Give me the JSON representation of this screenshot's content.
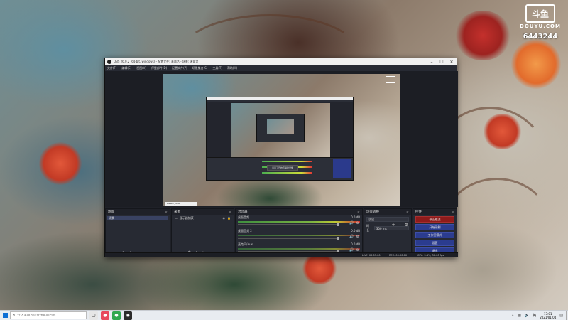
{
  "watermark": {
    "brand_text": "斗鱼",
    "domain": "DOUYU.COM",
    "room_id": "6443244"
  },
  "obs": {
    "title": "OBS 26.0.2 (64-bit, windows) - 配置文件: 未命名 - 场景: 未命名",
    "menu": [
      "文件(F)",
      "编辑(E)",
      "视图(V)",
      "停靠部件(D)",
      "配置文件(P)",
      "场景集合(S)",
      "工具(T)",
      "帮助(H)"
    ],
    "preview": {
      "status_text": "stealth_4d6c",
      "nested_tooltip": "设置了开始直播时录像"
    },
    "scenes": {
      "header": "场景",
      "items": [
        "场景"
      ],
      "toolbar": [
        "+",
        "−",
        "∧",
        "∨"
      ]
    },
    "sources": {
      "header": "来源",
      "items": [
        {
          "name": "显示器捕获"
        }
      ],
      "toolbar": [
        "+",
        "−",
        "⚙",
        "∧",
        "∨"
      ]
    },
    "mixer": {
      "header": "混音器",
      "channels": [
        {
          "name": "桌面音频",
          "db": "0.0 dB"
        },
        {
          "name": "桌面音频 2",
          "db": "0.0 dB"
        },
        {
          "name": "麦克风/Aux",
          "db": "0.0 dB"
        }
      ]
    },
    "transitions": {
      "header": "场景转换",
      "selected": "淡出",
      "duration_label": "时长",
      "duration_value": "300 ms"
    },
    "controls": {
      "header": "控件",
      "buttons": [
        {
          "label": "停止推流",
          "live": true
        },
        {
          "label": "开始录制",
          "live": false
        },
        {
          "label": "工作室模式",
          "live": false
        },
        {
          "label": "设置",
          "live": false
        },
        {
          "label": "退出",
          "live": false
        }
      ]
    },
    "status": {
      "live": "LIVE: 00:03:00",
      "rec": "REC: 00:00:00",
      "cpu": "CPU: 3.4%, 30.00 fps"
    }
  },
  "taskbar": {
    "search_placeholder": "在这里输入你要搜索的内容",
    "time": "17:01",
    "date": "2021/01/04",
    "lang": "英"
  }
}
